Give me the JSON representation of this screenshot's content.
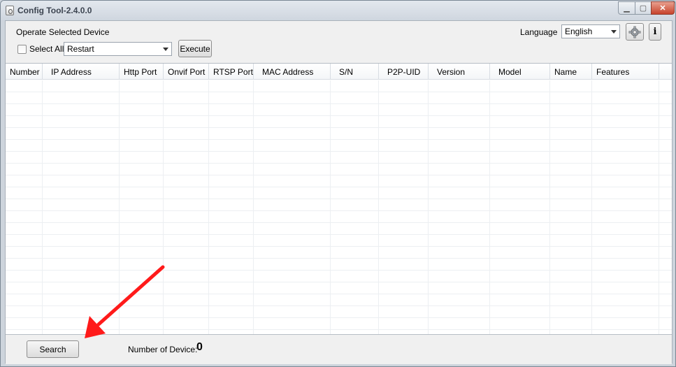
{
  "window": {
    "title": "Config Tool-2.4.0.0"
  },
  "toolbar": {
    "operate_label": "Operate Selected Device",
    "select_all_label": "Select All",
    "action_value": "Restart",
    "execute_label": "Execute",
    "language_label": "Language",
    "language_value": "English",
    "info_label": "i"
  },
  "table": {
    "columns": [
      "Number",
      "IP Address",
      "Http Port",
      "Onvif Port",
      "RTSP Port",
      "MAC Address",
      "S/N",
      "P2P-UID",
      "Version",
      "Model",
      "Name",
      "Features"
    ],
    "rows": []
  },
  "footer": {
    "search_label": "Search",
    "count_label": "Number of Device:",
    "count_value": "0"
  },
  "colors": {
    "annotation_arrow": "#ff1a1a"
  }
}
